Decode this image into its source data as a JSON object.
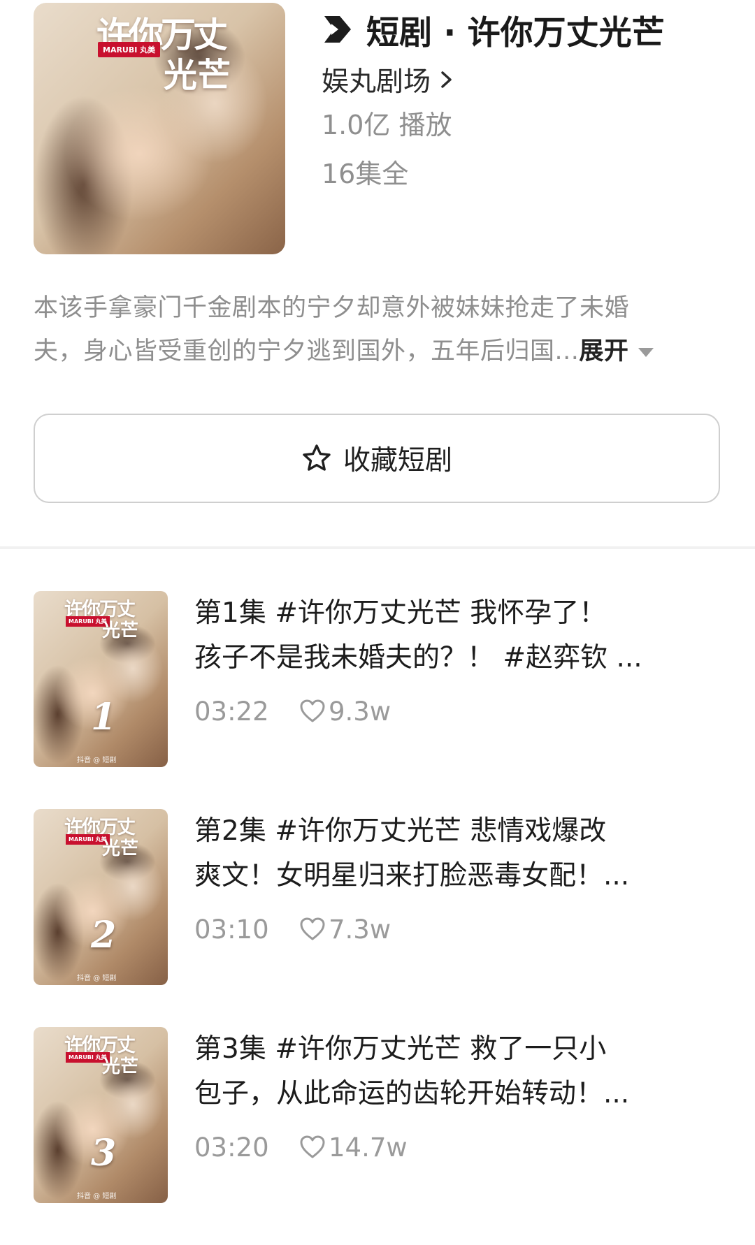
{
  "show": {
    "cover": {
      "title": "许你万丈",
      "title_line2": "光芒",
      "badge": "MARUBI 丸美"
    },
    "title": "短剧 · 许你万丈光芒",
    "studio": "娱丸剧场",
    "plays": "1.0亿 播放",
    "episode_count": "16集全"
  },
  "description": {
    "line1": "本该手拿豪门千金剧本的宁夕却意外被妹妹抢走了未婚",
    "line2": "夫，身心皆受重创的宁夕逃到国外，五年后归国...",
    "expand_label": "展开"
  },
  "favorite_button": {
    "label": "收藏短剧"
  },
  "episodes": [
    {
      "thumb_number": "1",
      "title_line1": "第1集  #许你万丈光芒 我怀孕了！",
      "title_line2": "孩子不是我未婚夫的？！ #赵弈钦 ...",
      "duration": "03:22",
      "likes": "9.3w"
    },
    {
      "thumb_number": "2",
      "title_line1": "第2集  #许你万丈光芒  悲情戏爆改",
      "title_line2": "爽文！女明星归来打脸恶毒女配！...",
      "duration": "03:10",
      "likes": "7.3w"
    },
    {
      "thumb_number": "3",
      "title_line1": "第3集  #许你万丈光芒 救了一只小",
      "title_line2": "包子，从此命运的齿轮开始转动！...",
      "duration": "03:20",
      "likes": "14.7w"
    }
  ],
  "thumb": {
    "title": "许你万丈",
    "title_line2": "光芒",
    "badge": "MARUBI 丸美",
    "footer": "抖音  @ 短剧"
  },
  "icons": {
    "logo": "short-drama-logo-icon",
    "chevron": "chevron-right-icon",
    "caret": "caret-down-icon",
    "star": "star-outline-icon",
    "heart": "heart-outline-icon"
  },
  "colors": {
    "text_primary": "#1f1f1f",
    "text_secondary": "#8f8f8f",
    "badge_red": "#c8102e",
    "border": "#cfcfcf"
  }
}
